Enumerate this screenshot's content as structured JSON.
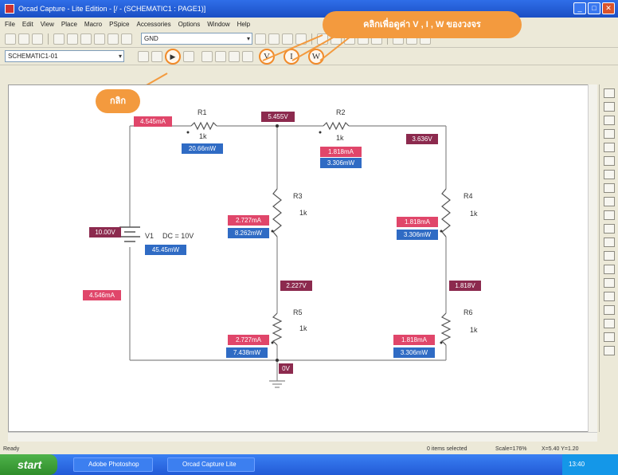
{
  "window": {
    "title": "Orcad Capture - Lite Edition - [/ - (SCHEMATIC1 : PAGE1)]",
    "menu": [
      "File",
      "Edit",
      "View",
      "Place",
      "Macro",
      "PSpice",
      "Accessories",
      "Options",
      "Window",
      "Help"
    ]
  },
  "toolbar": {
    "part_combo": "GND",
    "schematic_combo": "SCHEMATIC1-01",
    "bias_buttons": [
      "V",
      "I",
      "W"
    ]
  },
  "annotations": {
    "top_callout": "คลิกเพื่อดูค่า V , I , W ของวงจร",
    "click_callout": "กลิก"
  },
  "schematic": {
    "components": {
      "R1": {
        "name": "R1",
        "value": "1k"
      },
      "R2": {
        "name": "R2",
        "value": "1k"
      },
      "R3": {
        "name": "R3",
        "value": "1k"
      },
      "R4": {
        "name": "R4",
        "value": "1k"
      },
      "R5": {
        "name": "R5",
        "value": "1k"
      },
      "R6": {
        "name": "R6",
        "value": "1k"
      },
      "V1": {
        "name": "V1",
        "value": "DC = 10V"
      }
    },
    "voltage_labels": {
      "node_top_mid": "5.455V",
      "node_top_right": "3.636V",
      "source": "10.00V",
      "node_mid": "2.227V",
      "node_right_mid": "1.818V",
      "ground": "0V"
    },
    "current_labels": {
      "r1": "4.545mA",
      "r2": "1.818mA",
      "r3": "2.727mA",
      "r4": "1.818mA",
      "source": "4.546mA",
      "r5": "2.727mA",
      "r6": "1.818mA"
    },
    "power_labels": {
      "r1": "20.66mW",
      "r2": "3.306mW",
      "r3": "8.262mW",
      "r4": "3.306mW",
      "source": "45.45mW",
      "r5": "7.438mW",
      "r6": "3.306mW"
    }
  },
  "status": {
    "ready": "Ready",
    "selected": "0 items selected",
    "scale": "Scale=176%",
    "coords": "X=5.40  Y=1.20"
  },
  "taskbar": {
    "start": "start",
    "tasks": [
      "Adobe Photoshop",
      "Orcad Capture Lite"
    ],
    "clock": "13:40"
  },
  "colors": {
    "voltage": "#8c2a4e",
    "current": "#e0466a",
    "power": "#2f6bc4",
    "callout": "#f39a3e"
  }
}
